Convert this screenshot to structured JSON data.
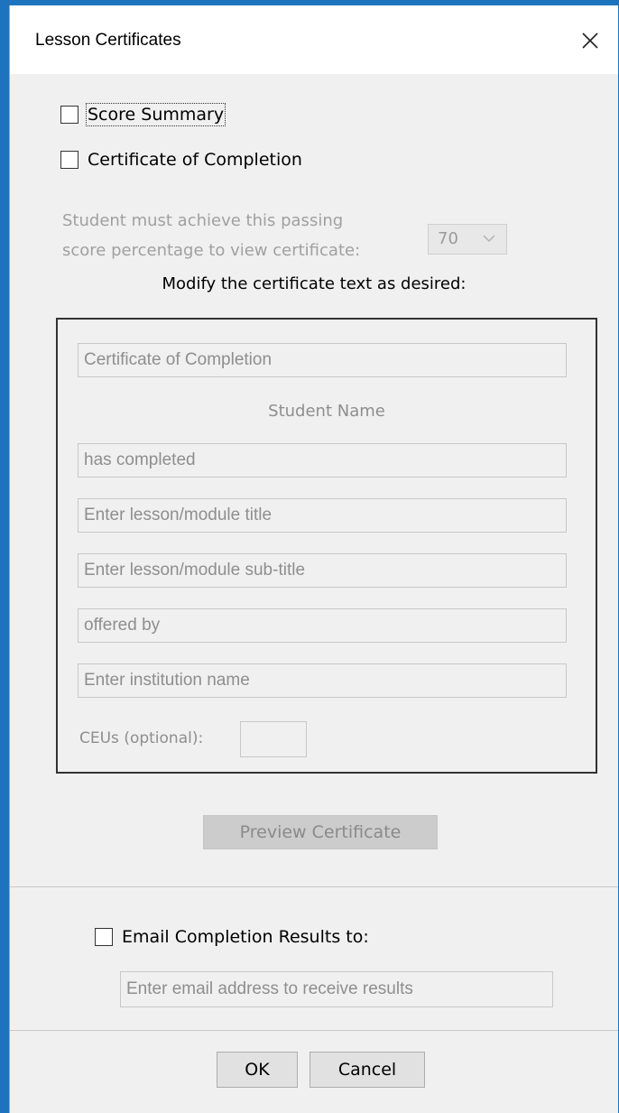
{
  "window": {
    "title": "Lesson Certificates"
  },
  "options": {
    "score_summary_label": "Score Summary",
    "certificate_label": "Certificate of Completion"
  },
  "passing": {
    "line1": "Student must achieve this passing",
    "line2": "score percentage to view certificate:",
    "value": "70"
  },
  "certificate": {
    "heading": "Modify the certificate text as desired:",
    "title_value": "Certificate of Completion",
    "student_name": "Student Name",
    "completed_value": "has completed",
    "lesson_title_placeholder": "Enter lesson/module title",
    "lesson_subtitle_placeholder": "Enter lesson/module sub-title",
    "offered_by_value": "offered by",
    "institution_placeholder": "Enter institution name",
    "ceus_label": "CEUs (optional):",
    "preview_label": "Preview Certificate"
  },
  "email": {
    "label": "Email Completion Results to:",
    "placeholder": "Enter email address to receive results"
  },
  "footer": {
    "ok_label": "OK",
    "cancel_label": "Cancel"
  }
}
